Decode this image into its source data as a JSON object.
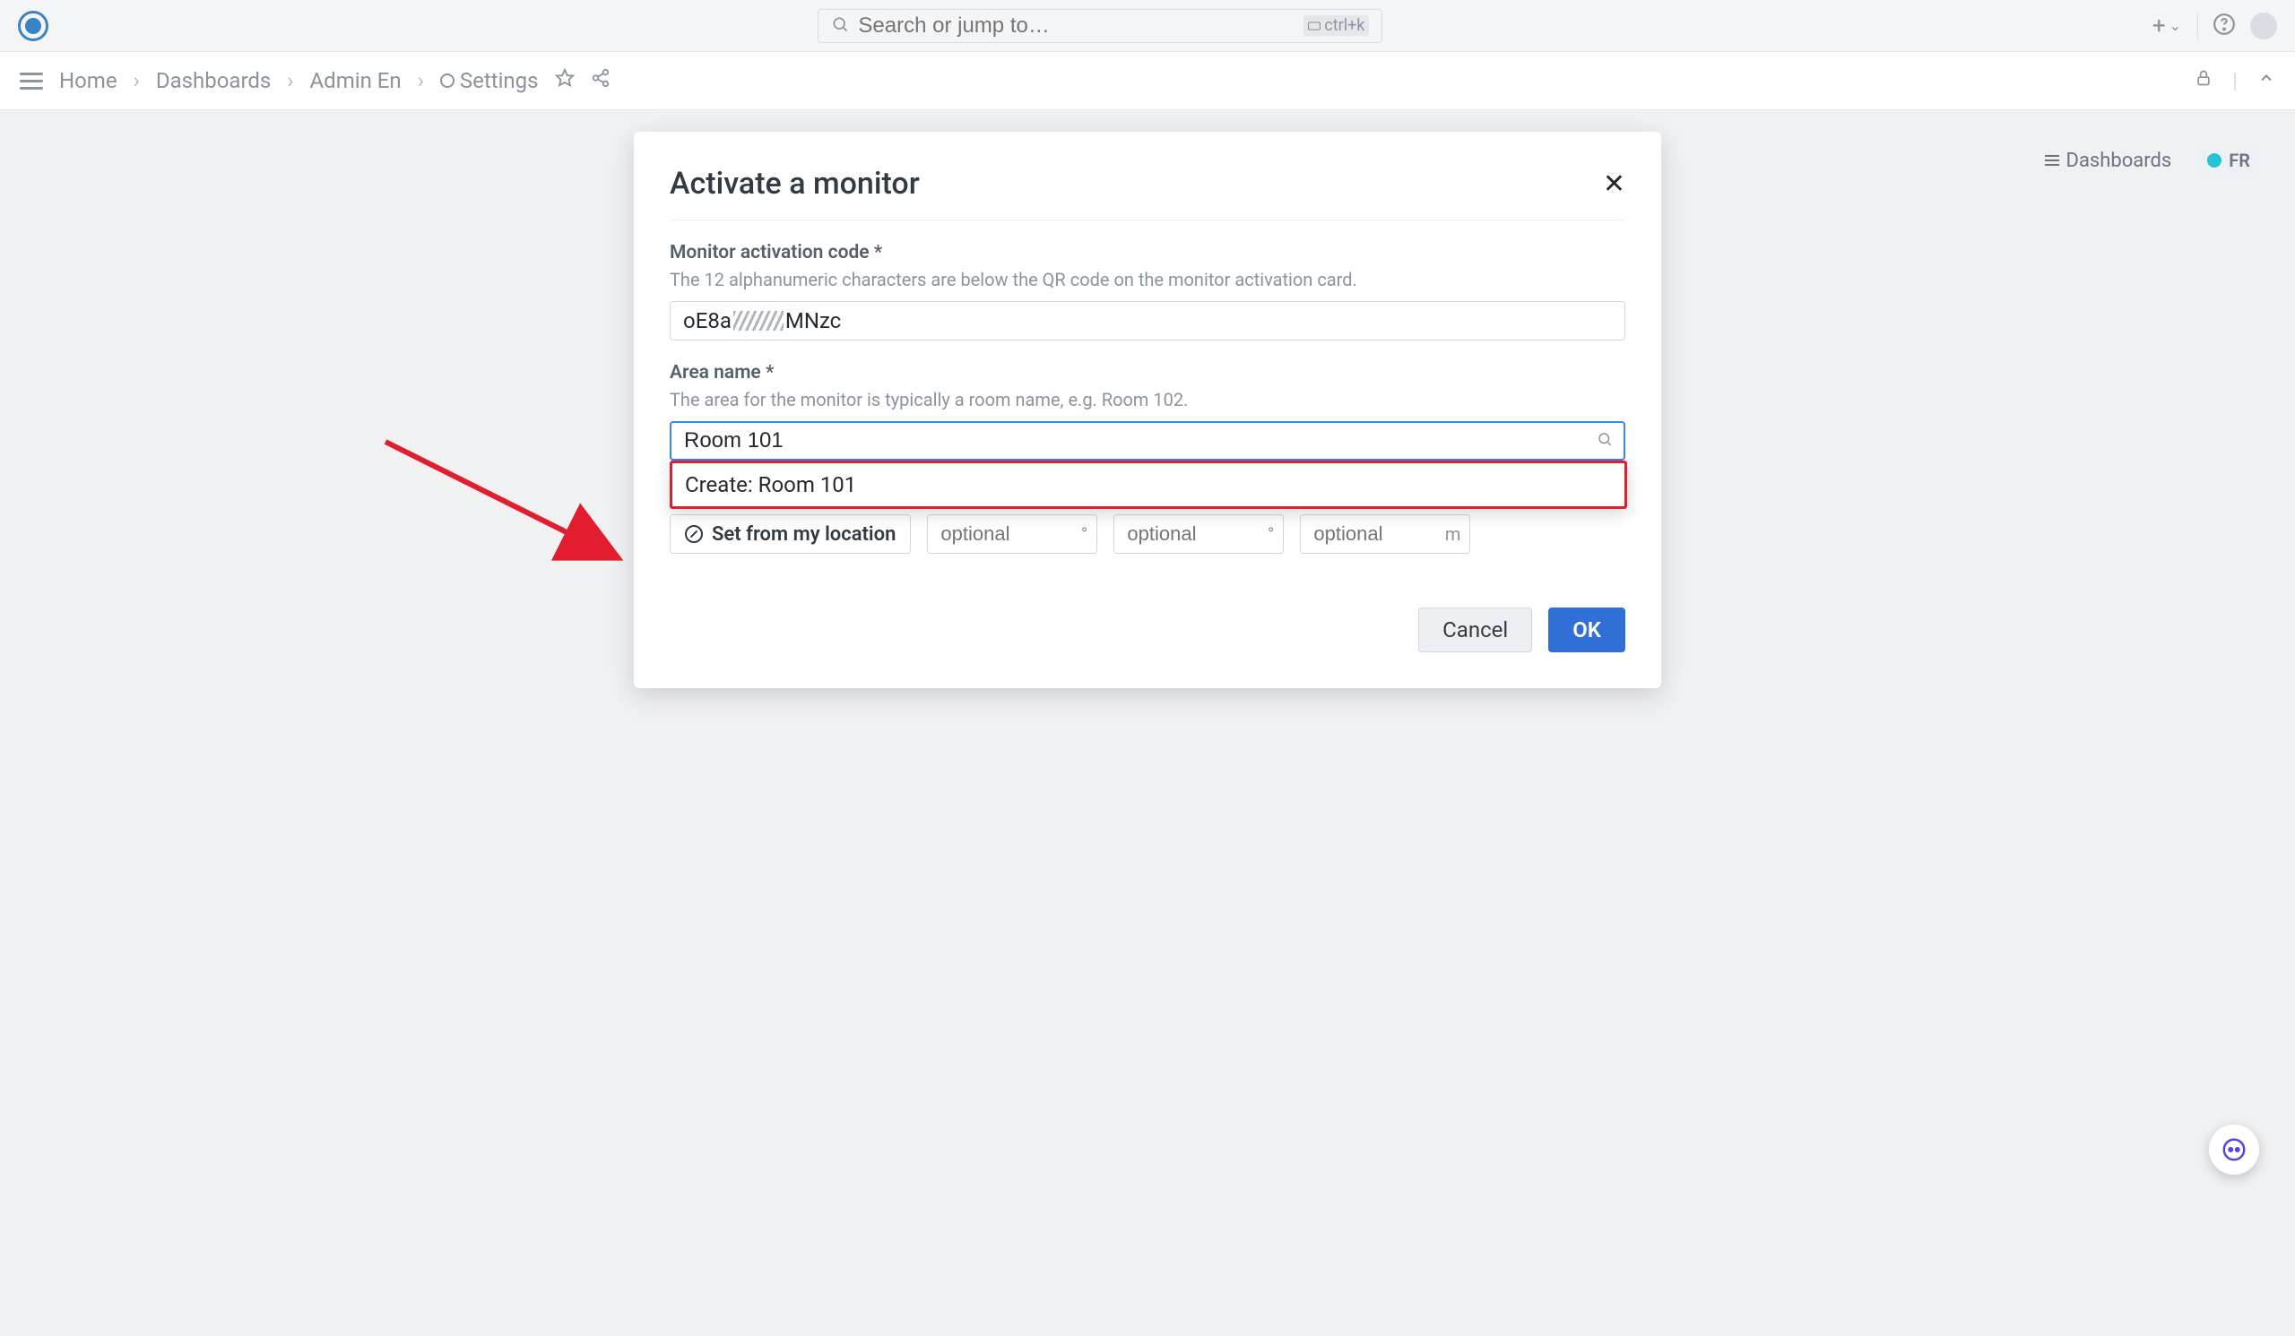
{
  "topbar": {
    "search_placeholder": "Search or jump to…",
    "shortcut": "ctrl+k"
  },
  "breadcrumb": {
    "items": [
      "Home",
      "Dashboards",
      "Admin En",
      "Settings"
    ]
  },
  "toolbar": {
    "dashboards_label": "Dashboards",
    "lang_label": "FR"
  },
  "modal": {
    "title": "Activate a monitor",
    "code_label": "Monitor activation code *",
    "code_help": "The 12 alphanumeric characters are below the QR code on the monitor activation card.",
    "code_value_prefix": "oE8a",
    "code_value_suffix": "MNzc",
    "area_label": "Area name *",
    "area_help": "The area for the monitor is typically a room name, e.g. Room 102.",
    "area_value": "Room 101",
    "dropdown_option": "Create: Room 101",
    "setloc_label": "Set from my location",
    "optional_placeholder": "optional",
    "unit_deg": "°",
    "unit_m": "m",
    "cancel_label": "Cancel",
    "ok_label": "OK"
  }
}
